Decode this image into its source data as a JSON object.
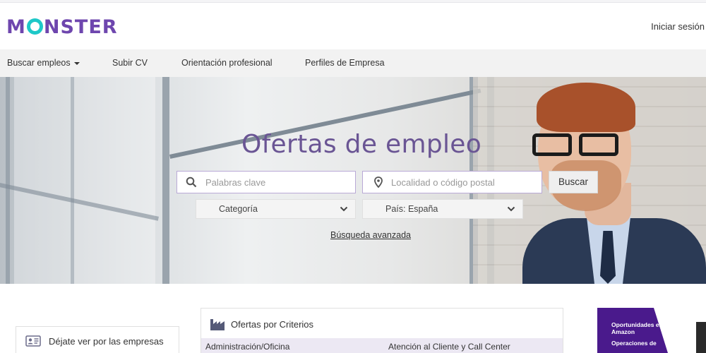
{
  "header": {
    "logo": {
      "pre": "M",
      "post": "NSTER"
    },
    "signin_label": "Iniciar sesión"
  },
  "nav": {
    "items": [
      {
        "label": "Buscar empleos",
        "has_dropdown": true
      },
      {
        "label": "Subir CV"
      },
      {
        "label": "Orientación profesional"
      },
      {
        "label": "Perfiles de Empresa"
      }
    ]
  },
  "hero": {
    "title": "Ofertas de empleo",
    "keywords": {
      "placeholder": "Palabras clave",
      "icon": "search-icon"
    },
    "location": {
      "placeholder": "Localidad o código postal",
      "icon": "location-pin-icon"
    },
    "search_button": "Buscar",
    "category_select": {
      "value": "Categoría"
    },
    "country_select": {
      "value": "País: España"
    },
    "advanced_link": "Búsqueda avanzada"
  },
  "sections": {
    "left_card": {
      "label": "Déjate ver por las empresas",
      "icon": "id-card-icon"
    },
    "criteria": {
      "title": "Ofertas por Criterios",
      "icon": "factory-icon",
      "categories": [
        "Administración/Oficina",
        "Atención al Cliente y Call Center"
      ]
    },
    "ad": {
      "text": "Oportunidades en Amazon",
      "text2": "Operaciones de"
    }
  },
  "colors": {
    "brand_purple": "#6e46ae",
    "logo_teal": "#1ec8c8",
    "title_purple": "#6a5594",
    "ad_purple": "#4a1a8c"
  }
}
